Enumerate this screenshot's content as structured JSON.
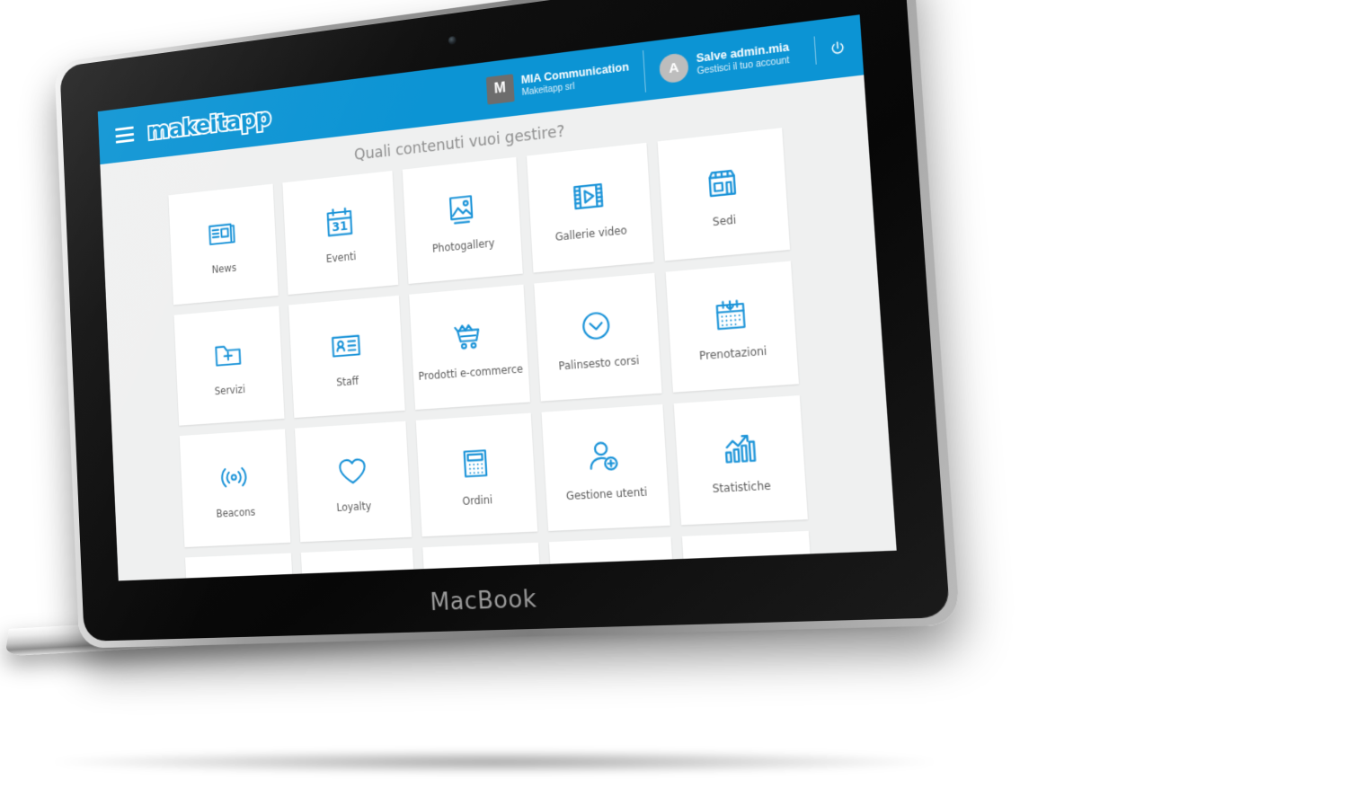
{
  "device": {
    "model_label": "MacBook",
    "camera_icon": "camera-dot"
  },
  "topbar": {
    "menu_icon": "hamburger-menu-icon",
    "brand": "makeitapp",
    "brand_color": "#0c94d4",
    "organization": {
      "avatar_initial": "M",
      "name": "MIA Communication",
      "subtitle": "Makeitapp srl"
    },
    "user": {
      "avatar_initial": "A",
      "greeting": "Salve admin.mia",
      "subtitle": "Gestisci il tuo account"
    },
    "logout_icon": "power-icon"
  },
  "main": {
    "title": "Quali contenuti vuoi gestire?",
    "accent_color": "#1a93d8",
    "background_color": "#eff0f0",
    "tiles": [
      {
        "label": "News",
        "icon": "news-icon"
      },
      {
        "label": "Eventi",
        "icon": "calendar-31-icon"
      },
      {
        "label": "Photogallery",
        "icon": "image-icon"
      },
      {
        "label": "Gallerie video",
        "icon": "film-play-icon"
      },
      {
        "label": "Sedi",
        "icon": "storefront-icon"
      },
      {
        "label": "Servizi",
        "icon": "folder-plus-icon"
      },
      {
        "label": "Staff",
        "icon": "id-card-icon"
      },
      {
        "label": "Prodotti e-commerce",
        "icon": "shopping-cart-icon"
      },
      {
        "label": "Palinsesto corsi",
        "icon": "clock-icon"
      },
      {
        "label": "Prenotazioni",
        "icon": "calendar-booking-icon"
      },
      {
        "label": "Beacons",
        "icon": "beacon-signal-icon"
      },
      {
        "label": "Loyalty",
        "icon": "heart-icon"
      },
      {
        "label": "Ordini",
        "icon": "calculator-icon"
      },
      {
        "label": "Gestione utenti",
        "icon": "user-add-icon"
      },
      {
        "label": "Statistiche",
        "icon": "bar-chart-arrow-icon"
      },
      {
        "label": "",
        "icon": "phone-info-icon"
      },
      {
        "label": "",
        "icon": "map-guide-icon"
      },
      {
        "label": "",
        "icon": "bookmark-book-icon"
      },
      {
        "label": "",
        "icon": "price-tags-icon"
      },
      {
        "label": "",
        "icon": "home-icon"
      }
    ]
  }
}
